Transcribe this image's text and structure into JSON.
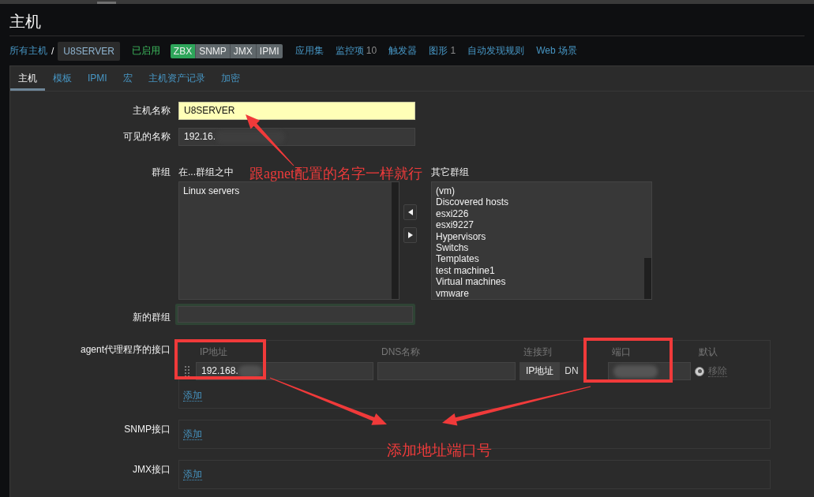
{
  "page": {
    "title": "主机"
  },
  "breadcrumb": {
    "root": "所有主机",
    "separator": "/",
    "current": "U8SERVER"
  },
  "status": "已启用",
  "availability": [
    {
      "label": "ZBX",
      "available": true
    },
    {
      "label": "SNMP",
      "available": false
    },
    {
      "label": "JMX",
      "available": false
    },
    {
      "label": "IPMI",
      "available": false
    }
  ],
  "links": [
    {
      "label": "应用集"
    },
    {
      "label": "监控项",
      "count": "10"
    },
    {
      "label": "触发器"
    },
    {
      "label": "图形",
      "count": "1"
    },
    {
      "label": "自动发现规则"
    },
    {
      "label": "Web 场景"
    }
  ],
  "tabs": [
    {
      "label": "主机",
      "selected": true
    },
    {
      "label": "模板",
      "selected": false
    },
    {
      "label": "IPMI",
      "selected": false
    },
    {
      "label": "宏",
      "selected": false
    },
    {
      "label": "主机资产记录",
      "selected": false
    },
    {
      "label": "加密",
      "selected": false
    }
  ],
  "form": {
    "host_name": {
      "label": "主机名称",
      "value": "U8SERVER"
    },
    "visible_name": {
      "label": "可见的名称",
      "value": "192.16."
    },
    "groups": {
      "label": "群组",
      "in_label": "在...群组之中",
      "in_items": [
        "Linux servers"
      ],
      "other_label": "其它群组",
      "other_items": [
        "(vm)",
        "Discovered hosts",
        "esxi226",
        "esxi9227",
        "Hypervisors",
        "Switchs",
        "Templates",
        "test machine1",
        "Virtual machines",
        "vmware"
      ]
    },
    "new_group": {
      "label": "新的群组"
    },
    "interfaces": [
      {
        "label": "agent代理程序的接口",
        "columns": [
          "IP地址",
          "DNS名称",
          "连接到",
          "端口",
          "默认"
        ],
        "rows": [
          {
            "ip": "192.168.",
            "connect": [
              {
                "label": "IP地址",
                "selected": true
              },
              {
                "label": "DN",
                "selected": false
              }
            ],
            "default": true,
            "remove": "移除"
          }
        ],
        "add": "添加"
      },
      {
        "label": "SNMP接口",
        "add": "添加"
      },
      {
        "label": "JMX接口",
        "add": "添加"
      }
    ]
  },
  "annotations": [
    {
      "text": "跟agnet配置的名字一样就行"
    },
    {
      "text": "添加地址端口号"
    }
  ]
}
